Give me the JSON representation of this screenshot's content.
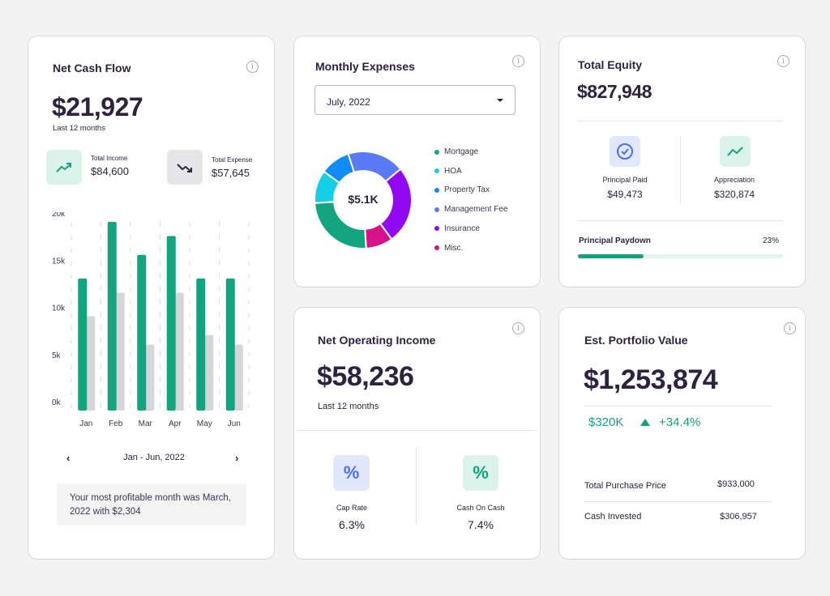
{
  "net_cash_flow": {
    "title": "Net Cash Flow",
    "value": "$21,927",
    "period": "Last 12 months",
    "income": {
      "label": "Total Income",
      "value": "$84,600",
      "icon": "trend-up-icon"
    },
    "expense": {
      "label": "Total Expense",
      "value": "$57,645",
      "icon": "trend-down-icon"
    },
    "range_label": "Jan - Jun, 2022",
    "prev_icon": "chevron-left-icon",
    "next_icon": "chevron-right-icon",
    "insight": "Your most profitable month was March, 2022 with $2,304"
  },
  "monthly_expenses": {
    "title": "Monthly Expenses",
    "selected_month": "July, 2022",
    "total_label": "$5.1K",
    "legend": [
      {
        "label": "Mortgage",
        "color": "#12a37f"
      },
      {
        "label": "HOA",
        "color": "#14cfe6"
      },
      {
        "label": "Property Tax",
        "color": "#0f8cf5"
      },
      {
        "label": "Management Fee",
        "color": "#5a7bf5"
      },
      {
        "label": "Insurance",
        "color": "#9208f0"
      },
      {
        "label": "Misc.",
        "color": "#d6128a"
      }
    ]
  },
  "total_equity": {
    "title": "Total Equity",
    "value": "$827,948",
    "principal_paid": {
      "label": "Principal Paid",
      "value": "$49,473",
      "icon": "check-circle-icon"
    },
    "appreciation": {
      "label": "Appreciation",
      "value": "$320,874",
      "icon": "trend-up-icon"
    },
    "paydown_label": "Principal Paydown",
    "paydown_percent_label": "23%",
    "paydown_fraction": 0.23
  },
  "noi": {
    "title": "Net Operating Income",
    "value": "$58,236",
    "period": "Last 12 months",
    "cap_rate": {
      "label": "Cap Rate",
      "value": "6.3%",
      "icon": "percent-icon"
    },
    "cash_on_cash": {
      "label": "Cash On Cash",
      "value": "7.4%",
      "icon": "percent-icon"
    }
  },
  "portfolio": {
    "title": "Est. Portfolio Value",
    "value": "$1,253,874",
    "change_amount": "$320K",
    "change_percent": "+34.4%",
    "rows": [
      {
        "label": "Total Purchase Price",
        "value": "$933,000"
      },
      {
        "label": "Cash Invested",
        "value": "$306,957"
      }
    ]
  },
  "colors": {
    "accent_green": "#12a37f",
    "expense_gray": "#d6d5d9",
    "text_dark": "#2d2340"
  },
  "chart_data": [
    {
      "type": "bar",
      "title": "Net Cash Flow",
      "categories": [
        "Jan",
        "Feb",
        "Mar",
        "Apr",
        "May",
        "Jun"
      ],
      "series": [
        {
          "name": "Income",
          "values": [
            14000,
            20000,
            16500,
            18500,
            14000,
            14000
          ]
        },
        {
          "name": "Expense",
          "values": [
            10000,
            12500,
            7000,
            12500,
            8000,
            7000
          ]
        }
      ],
      "yticks": [
        "0k",
        "5k",
        "10k",
        "15k",
        "20k"
      ],
      "ylim": [
        0,
        20000
      ],
      "grid": true
    },
    {
      "type": "pie",
      "title": "Monthly Expenses",
      "center_label": "$5.1K",
      "categories": [
        "Management Fee",
        "Insurance",
        "Misc.",
        "Mortgage",
        "HOA",
        "Property Tax"
      ],
      "values": [
        19,
        26,
        9,
        25,
        11,
        10
      ]
    }
  ]
}
